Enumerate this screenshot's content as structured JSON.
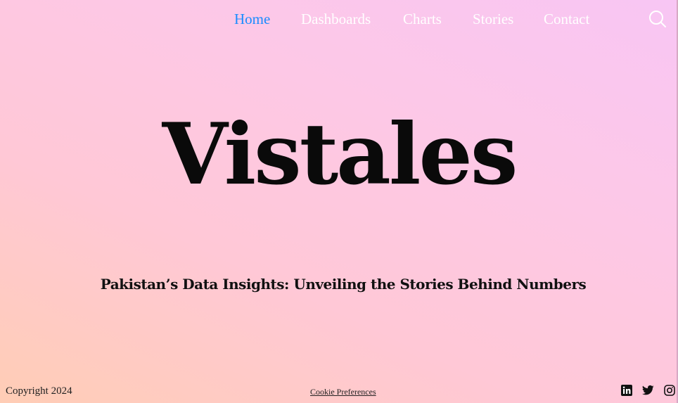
{
  "nav": {
    "items": [
      {
        "label": "Home",
        "active": true
      },
      {
        "label": "Dashboards",
        "active": false
      },
      {
        "label": "Charts",
        "active": false
      },
      {
        "label": "Stories",
        "active": false
      },
      {
        "label": "Contact",
        "active": false
      }
    ],
    "search_icon": "search-icon"
  },
  "hero": {
    "title": "Vistales",
    "tagline": "Pakistan’s Data Insights: Unveiling the Stories Behind Numbers"
  },
  "footer": {
    "copyright": "Copyright 2024",
    "cookie_link": "Cookie Preferences",
    "social_icons": [
      "linkedin-icon",
      "twitter-icon",
      "instagram-icon"
    ]
  },
  "colors": {
    "active_nav": "#1a8cff",
    "nav_text": "#ffffff",
    "text": "#111111",
    "gradient_start": "#ffcdb5",
    "gradient_end": "#f8c6f4"
  }
}
